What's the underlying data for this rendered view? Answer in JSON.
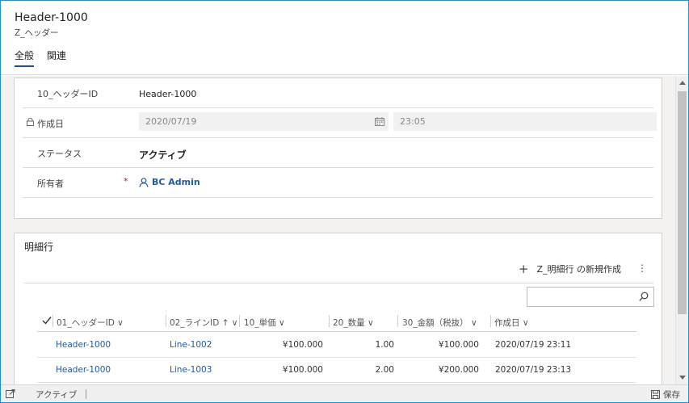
{
  "header": {
    "title": "Header-1000",
    "subtitle": "Z_ヘッダー"
  },
  "tabs": [
    {
      "label": "全般",
      "active": true
    },
    {
      "label": "関連",
      "active": false
    }
  ],
  "general": {
    "header_id_label": "10_ヘッダーID",
    "header_id_value": "Header-1000",
    "created_label": "作成日",
    "created_date": "2020/07/19",
    "created_time": "23:05",
    "status_label": "ステータス",
    "status_value": "アクティブ",
    "owner_label": "所有者",
    "owner_required": "*",
    "owner_value": "BC Admin"
  },
  "details": {
    "title": "明細行",
    "new_label": "Z_明細行 の新規作成",
    "more_label": "⋮",
    "search_placeholder": "",
    "columns": [
      {
        "label": "01_ヘッダーID ∨"
      },
      {
        "label": "02_ラインID ↑  ∨"
      },
      {
        "label": "10_単価 ∨"
      },
      {
        "label": "20_数量 ∨"
      },
      {
        "label": "30_金額（税抜） ∨"
      },
      {
        "label": "作成日 ∨"
      }
    ],
    "rows": [
      {
        "header_id": "Header-1000",
        "line_id": "Line-1002",
        "unit_price": "¥100.000",
        "quantity": "1.00",
        "amount": "¥100.000",
        "created": "2020/07/19 23:11"
      },
      {
        "header_id": "Header-1000",
        "line_id": "Line-1003",
        "unit_price": "¥100.000",
        "quantity": "2.00",
        "amount": "¥200.000",
        "created": "2020/07/19 23:13"
      }
    ]
  },
  "status_bar": {
    "status": "アクティブ",
    "save": "保存"
  },
  "colors": {
    "accent": "#1b4e8e",
    "link": "#1f5aa3",
    "required": "#c8102e",
    "frame": "#1e90d8"
  }
}
